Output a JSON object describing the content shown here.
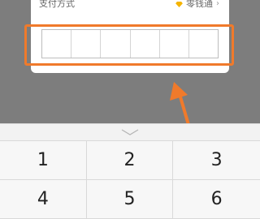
{
  "payment": {
    "method_label": "支付方式",
    "method_value": "零钱通",
    "method_icon": "diamond-icon",
    "pin_length": 6
  },
  "keypad": {
    "collapse_icon": "chevron-down-icon",
    "keys": [
      "1",
      "2",
      "3",
      "4",
      "5",
      "6"
    ]
  },
  "colors": {
    "highlight": "#f07a2b",
    "diamond": "#f5b400"
  }
}
